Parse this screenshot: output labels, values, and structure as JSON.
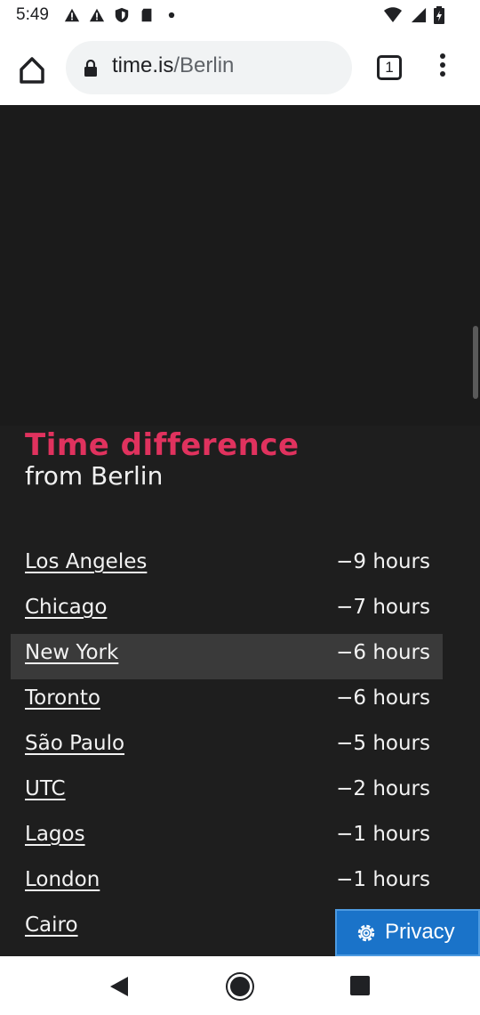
{
  "status": {
    "time": "5:49"
  },
  "browser": {
    "url_domain": "time.is",
    "url_path": "/Berlin",
    "tab_count": "1"
  },
  "page": {
    "heading_title": "Time difference",
    "heading_sub": "from Berlin",
    "rows": [
      {
        "city": "Los Angeles",
        "diff": "−9 hours"
      },
      {
        "city": "Chicago",
        "diff": "−7 hours"
      },
      {
        "city": "New York",
        "diff": "−6 hours"
      },
      {
        "city": "Toronto",
        "diff": "−6 hours"
      },
      {
        "city": "São Paulo",
        "diff": "−5 hours"
      },
      {
        "city": "UTC",
        "diff": "−2 hours"
      },
      {
        "city": "Lagos",
        "diff": "−1 hours"
      },
      {
        "city": "London",
        "diff": "−1 hours"
      },
      {
        "city": "Cairo",
        "diff": ""
      }
    ],
    "privacy_label": "Privacy"
  },
  "colors": {
    "accent": "#e0325e",
    "background": "#1e1e1e",
    "privacy_button": "#1a73c9"
  }
}
